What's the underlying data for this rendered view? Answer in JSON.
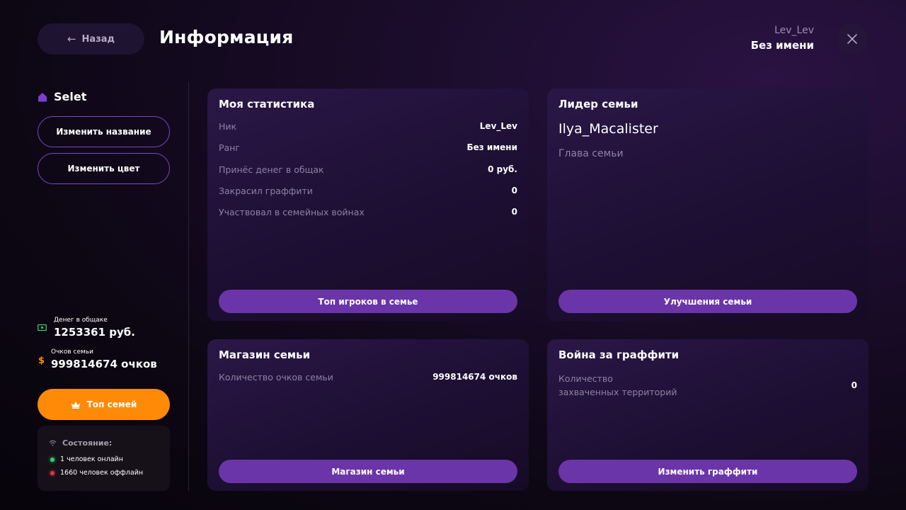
{
  "header": {
    "back_label": "Назад",
    "title": "Информация",
    "user_name": "Lev_Lev",
    "user_rank": "Без имени"
  },
  "sidebar": {
    "family_name": "Selet",
    "rename_button": "Изменить название",
    "recolor_button": "Изменить цвет",
    "bank_label": "Денег в общаке",
    "bank_value": "1253361 руб.",
    "points_label": "Очков семьи",
    "points_value": "999814674 очков",
    "top_button": "Топ семей",
    "status": {
      "title": "Состояние:",
      "online": "1 человек онлайн",
      "offline": "1660 человек оффлайн"
    }
  },
  "stats_card": {
    "title": "Моя статистика",
    "rows": [
      {
        "label": "Ник",
        "value": "Lev_Lev"
      },
      {
        "label": "Ранг",
        "value": "Без имени"
      },
      {
        "label": "Принёс денег в общак",
        "value": "0 руб."
      },
      {
        "label": "Закрасил граффити",
        "value": "0"
      },
      {
        "label": "Участвовал в семейных войнах",
        "value": "0"
      }
    ],
    "button": "Топ игроков в семье"
  },
  "leader_card": {
    "title": "Лидер семьи",
    "name": "Ilya_Macalister",
    "role": "Глава семьи",
    "button": "Улучшения семьи"
  },
  "shop_card": {
    "title": "Магазин семьи",
    "label": "Количество очков семьи",
    "value": "999814674 очков",
    "button": "Магазин семьи"
  },
  "war_card": {
    "title": "Война за граффити",
    "label_line1": "Количество",
    "label_line2": "захваченных территорий",
    "value": "0",
    "button": "Изменить граффити"
  },
  "colors": {
    "accent_purple": "#6a35a8",
    "accent_orange": "#ff8a07",
    "online": "#2fd16b",
    "offline": "#e0334a"
  }
}
